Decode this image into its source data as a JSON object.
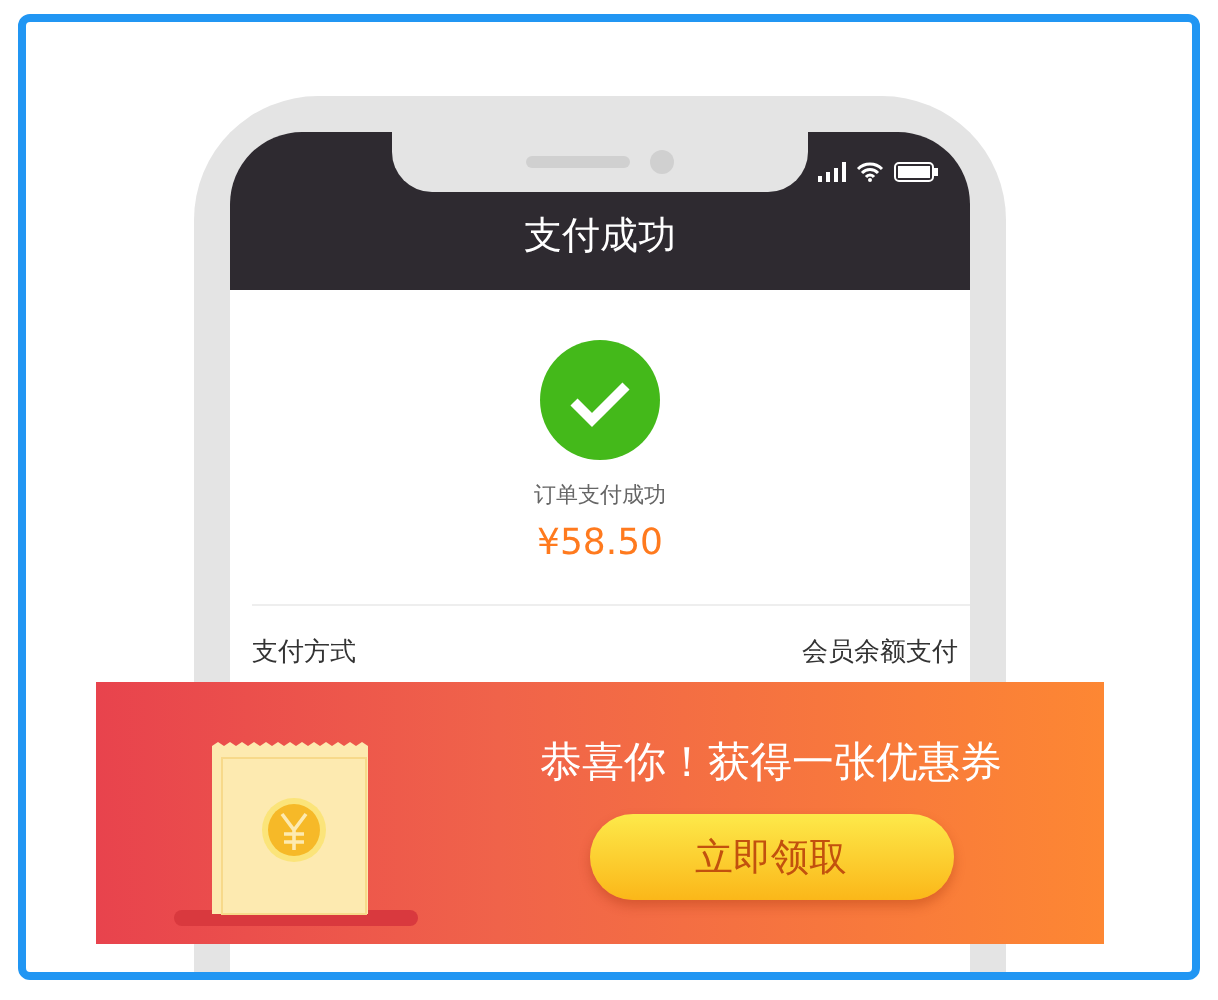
{
  "phone": {
    "nav_title": "支付成功",
    "status": "订单支付成功",
    "amount": "¥58.50",
    "rows": [
      {
        "label": "支付方式",
        "value": "会员余额支付"
      }
    ]
  },
  "coupon_banner": {
    "title": "恭喜你！获得一张优惠券",
    "button": "立即领取"
  }
}
